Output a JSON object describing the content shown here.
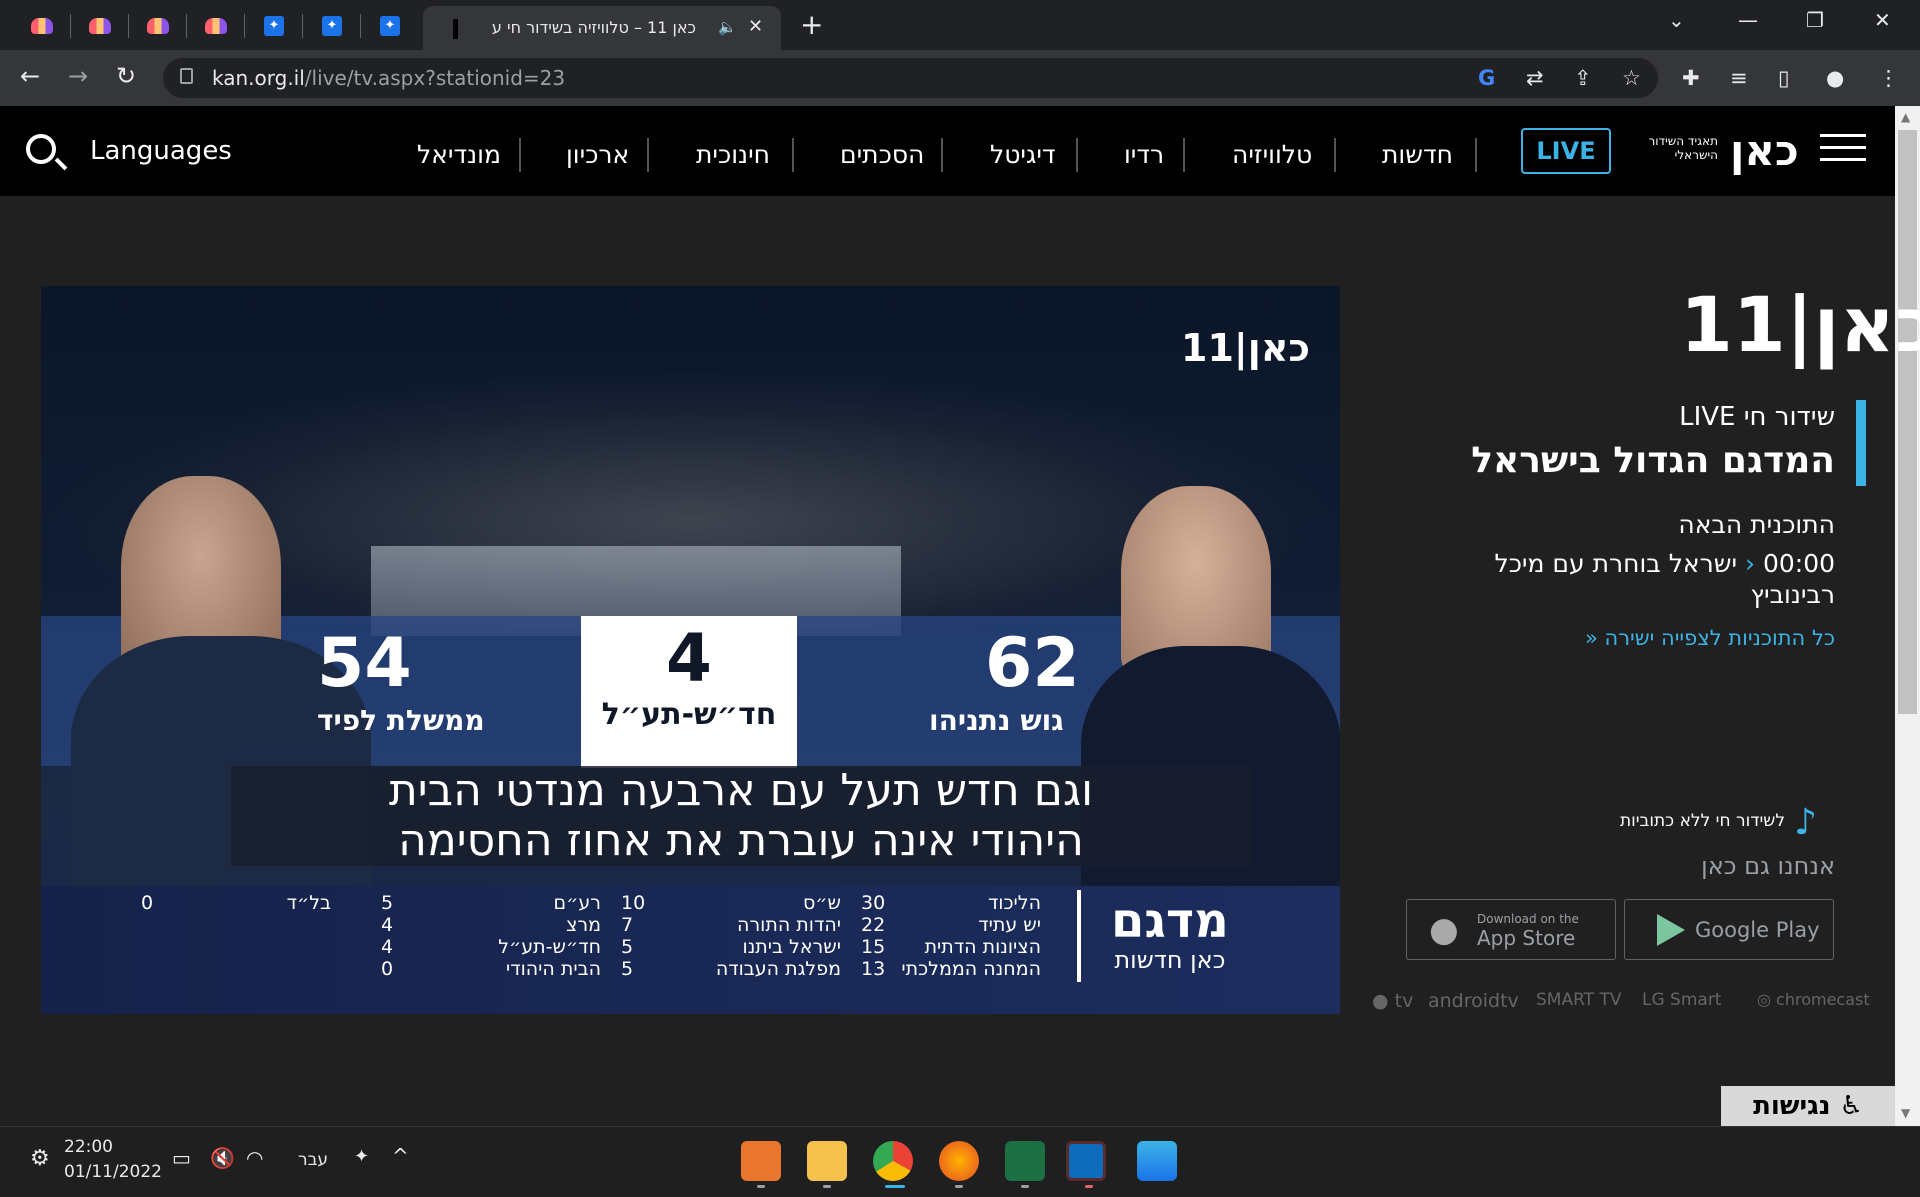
{
  "browser": {
    "active_tab_title": "כאן 11 – טלוויזיה בשידור חי ע",
    "active_tab_audio": "🔈",
    "url_host": "kan.org.il",
    "url_path": "/live/tv.aspx?stationid=23",
    "pinned_tabs": [
      "miro",
      "miro",
      "miro",
      "miro",
      "dropbox",
      "dropbox",
      "dropbox"
    ]
  },
  "site": {
    "logo": "כאן",
    "broadcaster": "תאגיד השידור הישראלי",
    "live_label": "LIVE",
    "nav": [
      "חדשות",
      "טלוויזיה",
      "רדיו",
      "דיגיטל",
      "הסכתים",
      "חינוכית",
      "ארכיון",
      "מונדיאל"
    ],
    "languages": "Languages"
  },
  "video": {
    "logo": "כאן|11",
    "left_seats": "54",
    "left_bloc": "ממשלת לפיד",
    "center_seats": "4",
    "center_party": "חד״ש-תע״ל",
    "right_seats": "62",
    "right_bloc": "גוש נתניהו",
    "caption_line1": "וגם חדש תעל עם ארבעה מנדטי הבית",
    "caption_line2": "היהודי אינה עוברת את אחוז החסימה",
    "madgam_title": "מדגם",
    "madgam_sub": "כאן חדשות",
    "results": [
      [
        [
          "הליכוד",
          "30"
        ],
        [
          "יש עתיד",
          "22"
        ],
        [
          "הציונות הדתית",
          "15"
        ],
        [
          "המחנה הממלכתי",
          "13"
        ]
      ],
      [
        [
          "ש״ס",
          "10"
        ],
        [
          "יהדות התורה",
          "7"
        ],
        [
          "ישראל ביתנו",
          "5"
        ],
        [
          "מפלגת העבודה",
          "5"
        ]
      ],
      [
        [
          "רע״ם",
          "5"
        ],
        [
          "מרצ",
          "4"
        ],
        [
          "חד״ש-תע״ל",
          "4"
        ],
        [
          "הבית היהודי",
          "0"
        ]
      ],
      [
        [
          "בל״ד",
          "0"
        ]
      ]
    ]
  },
  "panel": {
    "channel_logo": "כאן|11",
    "live_title": "שידור חי LIVE",
    "show_title": "המדגם הגדול בישראל",
    "next_label": "התוכנית הבאה",
    "next_time": "00:00",
    "next_show_line1": "ישראל בוחרת עם מיכל",
    "next_show_line2": "רבינוביץ",
    "all_programs": "כל התוכניות לצפייה ישירה",
    "no_subtitles": "לשידור חי ללא כתוביות",
    "we_are_also": "אנחנו גם כאן",
    "app_store_small": "Download on the",
    "app_store": "App Store",
    "google_play": "Google Play",
    "tv_platforms": [
      "tv",
      "androidtv",
      "SMART TV",
      "LG Smart",
      "chromecast"
    ],
    "accessibility": "נגישות"
  },
  "taskbar": {
    "time": "22:00",
    "date": "01/11/2022",
    "lang": "עבר"
  }
}
